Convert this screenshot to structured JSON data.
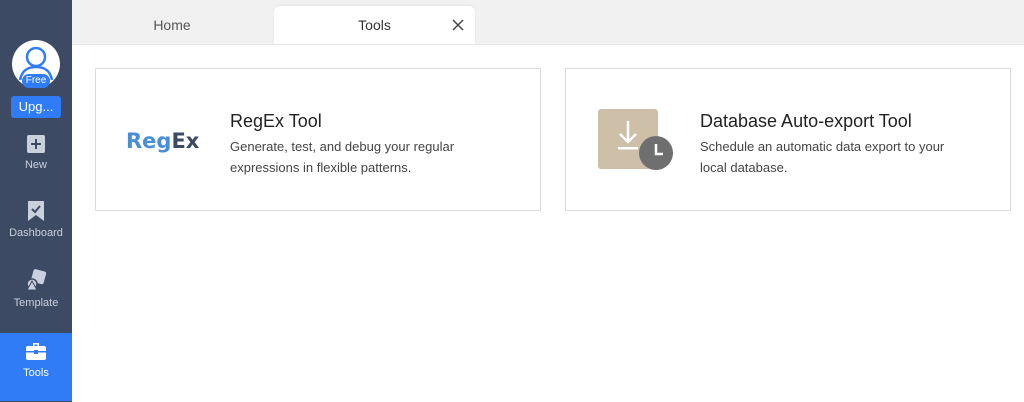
{
  "sidebar": {
    "free_badge": "Free",
    "upgrade_label": "Upg...",
    "items": [
      {
        "label": "New",
        "icon": "plus-square-icon"
      },
      {
        "label": "Dashboard",
        "icon": "bookmark-check-icon"
      },
      {
        "label": "Template",
        "icon": "template-icon"
      },
      {
        "label": "Tools",
        "icon": "toolbox-icon",
        "active": true
      }
    ]
  },
  "tabs": [
    {
      "label": "Home"
    },
    {
      "label": "Tools",
      "active": true
    }
  ],
  "cards": [
    {
      "title": "RegEx Tool",
      "description": "Generate, test, and debug your regular expressions in flexible patterns.",
      "logo_part1": "Reg",
      "logo_part2": "Ex"
    },
    {
      "title": "Database Auto-export Tool",
      "description": "Schedule an automatic data export to your local database.",
      "icon": "download-clock-icon"
    }
  ],
  "colors": {
    "sidebar_bg": "#3d4a63",
    "accent": "#2f7cf6",
    "regex_blue": "#4a8ed6",
    "db_icon_bg": "#cdbfa8",
    "clock_bg": "#6f6f6f"
  }
}
